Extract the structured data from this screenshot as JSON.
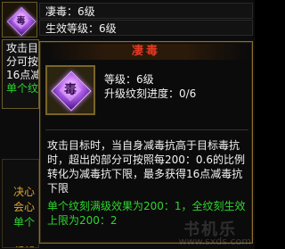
{
  "bg_panel": {
    "rows": [
      "凄毒：6级",
      "生效等级：6级"
    ],
    "desc_lines": [
      "攻击目",
      "分可按",
      "16点减",
      "单个纹"
    ],
    "lower_lines": [
      "决心",
      "会心",
      "单个",
      "凝望"
    ]
  },
  "tooltip": {
    "title": "凄毒",
    "icon_glyph": "毒",
    "level_line": "等级：6级",
    "progress_line": "升级纹刻进度：0/6",
    "description": "攻击目标时，当自身减毒抗高于目标毒抗时，超出的部分可按照每200：0.6的比例转化为减毒抗下限，最多获得16点减毒抗下限",
    "bonus": "单个纹刻满级效果为200：1，全纹刻生效上限为200：2"
  },
  "watermark": {
    "logo": "书机乐",
    "url": "www.sxds.com"
  },
  "colors": {
    "title_red": "#e43a24",
    "bonus_green": "#2fd52f",
    "frame_gold": "#8a6d2a",
    "gem_purple": "#b867f0"
  }
}
